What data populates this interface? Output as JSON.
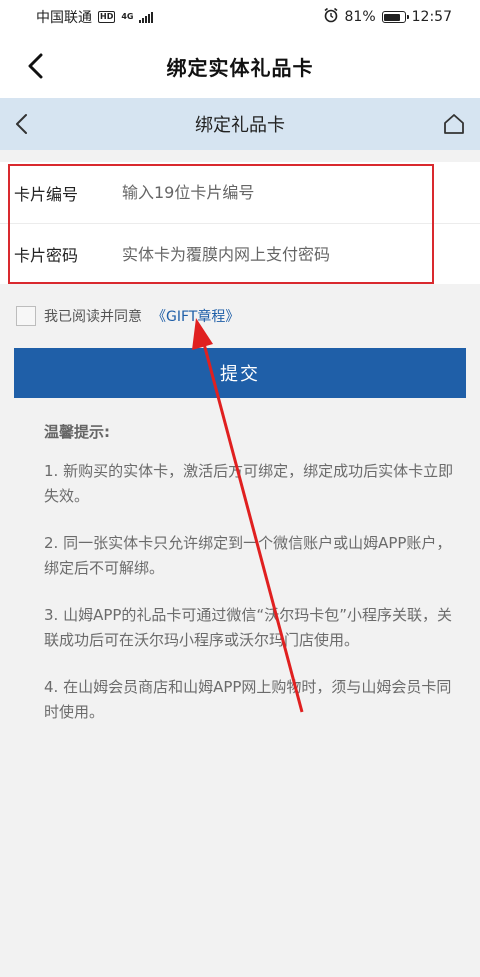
{
  "status_bar": {
    "carrier": "中国联通",
    "hd": "HD",
    "network": "4G",
    "battery_percent": "81%",
    "battery_level": 0.81,
    "time": "12:57"
  },
  "app_header": {
    "title": "绑定实体礼品卡"
  },
  "sub_header": {
    "title": "绑定礼品卡"
  },
  "form": {
    "card_number": {
      "label": "卡片编号",
      "placeholder": "输入19位卡片编号"
    },
    "card_password": {
      "label": "卡片密码",
      "placeholder": "实体卡为覆膜内网上支付密码"
    }
  },
  "agreement": {
    "text": "我已阅读并同意",
    "link": "《GIFT章程》"
  },
  "submit": {
    "label": "提交"
  },
  "tips": {
    "title": "温馨提示:",
    "items": [
      "1. 新购买的实体卡，激活后方可绑定，绑定成功后实体卡立即失效。",
      "2. 同一张实体卡只允许绑定到一个微信账户或山姆APP账户，绑定后不可解绑。",
      "3. 山姆APP的礼品卡可通过微信“沃尔玛卡包”小程序关联，关联成功后可在沃尔玛小程序或沃尔玛门店使用。",
      "4. 在山姆会员商店和山姆APP网上购物时，须与山姆会员卡同时使用。"
    ]
  },
  "colors": {
    "primary": "#1f5fa8",
    "sub_header_bg": "#d6e4f1",
    "annotation_red": "#d9292e"
  },
  "icons": [
    "back-arrow-icon",
    "home-icon",
    "alarm-icon",
    "battery-icon",
    "signal-icon"
  ]
}
